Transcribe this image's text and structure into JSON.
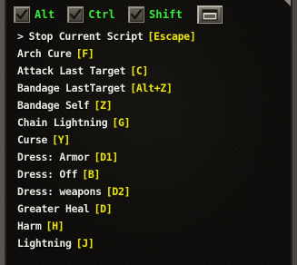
{
  "toolbar": {
    "modifiers": [
      {
        "label": "Alt",
        "checked": true
      },
      {
        "label": "Ctrl",
        "checked": true
      },
      {
        "label": "Shift",
        "checked": true
      }
    ],
    "window_button_icon": "window-icon"
  },
  "list": {
    "current_marker": ">",
    "items": [
      {
        "name": "Stop Current Script",
        "key": "[Escape]"
      },
      {
        "name": "Arch Cure",
        "key": "[F]"
      },
      {
        "name": "Attack Last Target",
        "key": "[C]"
      },
      {
        "name": "Bandage LastTarget",
        "key": "[Alt+Z]"
      },
      {
        "name": "Bandage Self",
        "key": "[Z]"
      },
      {
        "name": "Chain Lightning",
        "key": "[G]"
      },
      {
        "name": "Curse",
        "key": "[Y]"
      },
      {
        "name": "Dress: Armor",
        "key": "[D1]"
      },
      {
        "name": "Dress: Off",
        "key": "[B]"
      },
      {
        "name": "Dress: weapons",
        "key": "[D2]"
      },
      {
        "name": "Greater Heal",
        "key": "[D]"
      },
      {
        "name": "Harm",
        "key": "[H]"
      },
      {
        "name": "Lightning",
        "key": "[J]"
      }
    ]
  },
  "colors": {
    "modifier_label": "#3ee53e",
    "item_name": "#ecebe7",
    "hotkey": "#ebe317"
  }
}
